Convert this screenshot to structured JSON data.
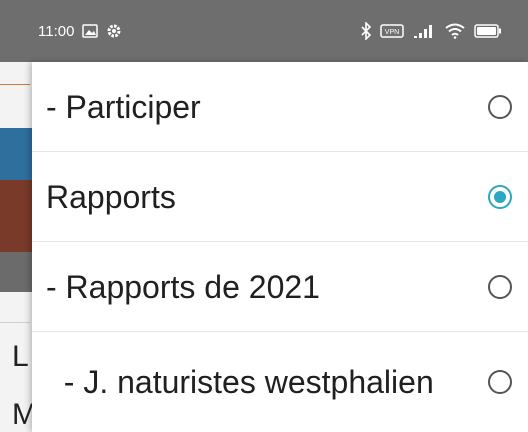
{
  "status_bar": {
    "time": "11:00",
    "left_icons": [
      "image-notification-icon",
      "gear-icon"
    ],
    "right_icons": [
      "bluetooth-icon",
      "vpn-icon",
      "signal-icon",
      "wifi-icon",
      "battery-icon"
    ]
  },
  "background": {
    "letters": [
      "L",
      "M"
    ]
  },
  "dialog": {
    "options": [
      {
        "label": "- Participer",
        "selected": false
      },
      {
        "label": "Rapports",
        "selected": true
      },
      {
        "label": "- Rapports de 2021",
        "selected": false
      },
      {
        "label": "  - J. naturistes westphalien",
        "selected": false
      }
    ]
  },
  "colors": {
    "accent": "#2aa7c2",
    "status_bar": "#6e6e6e"
  }
}
